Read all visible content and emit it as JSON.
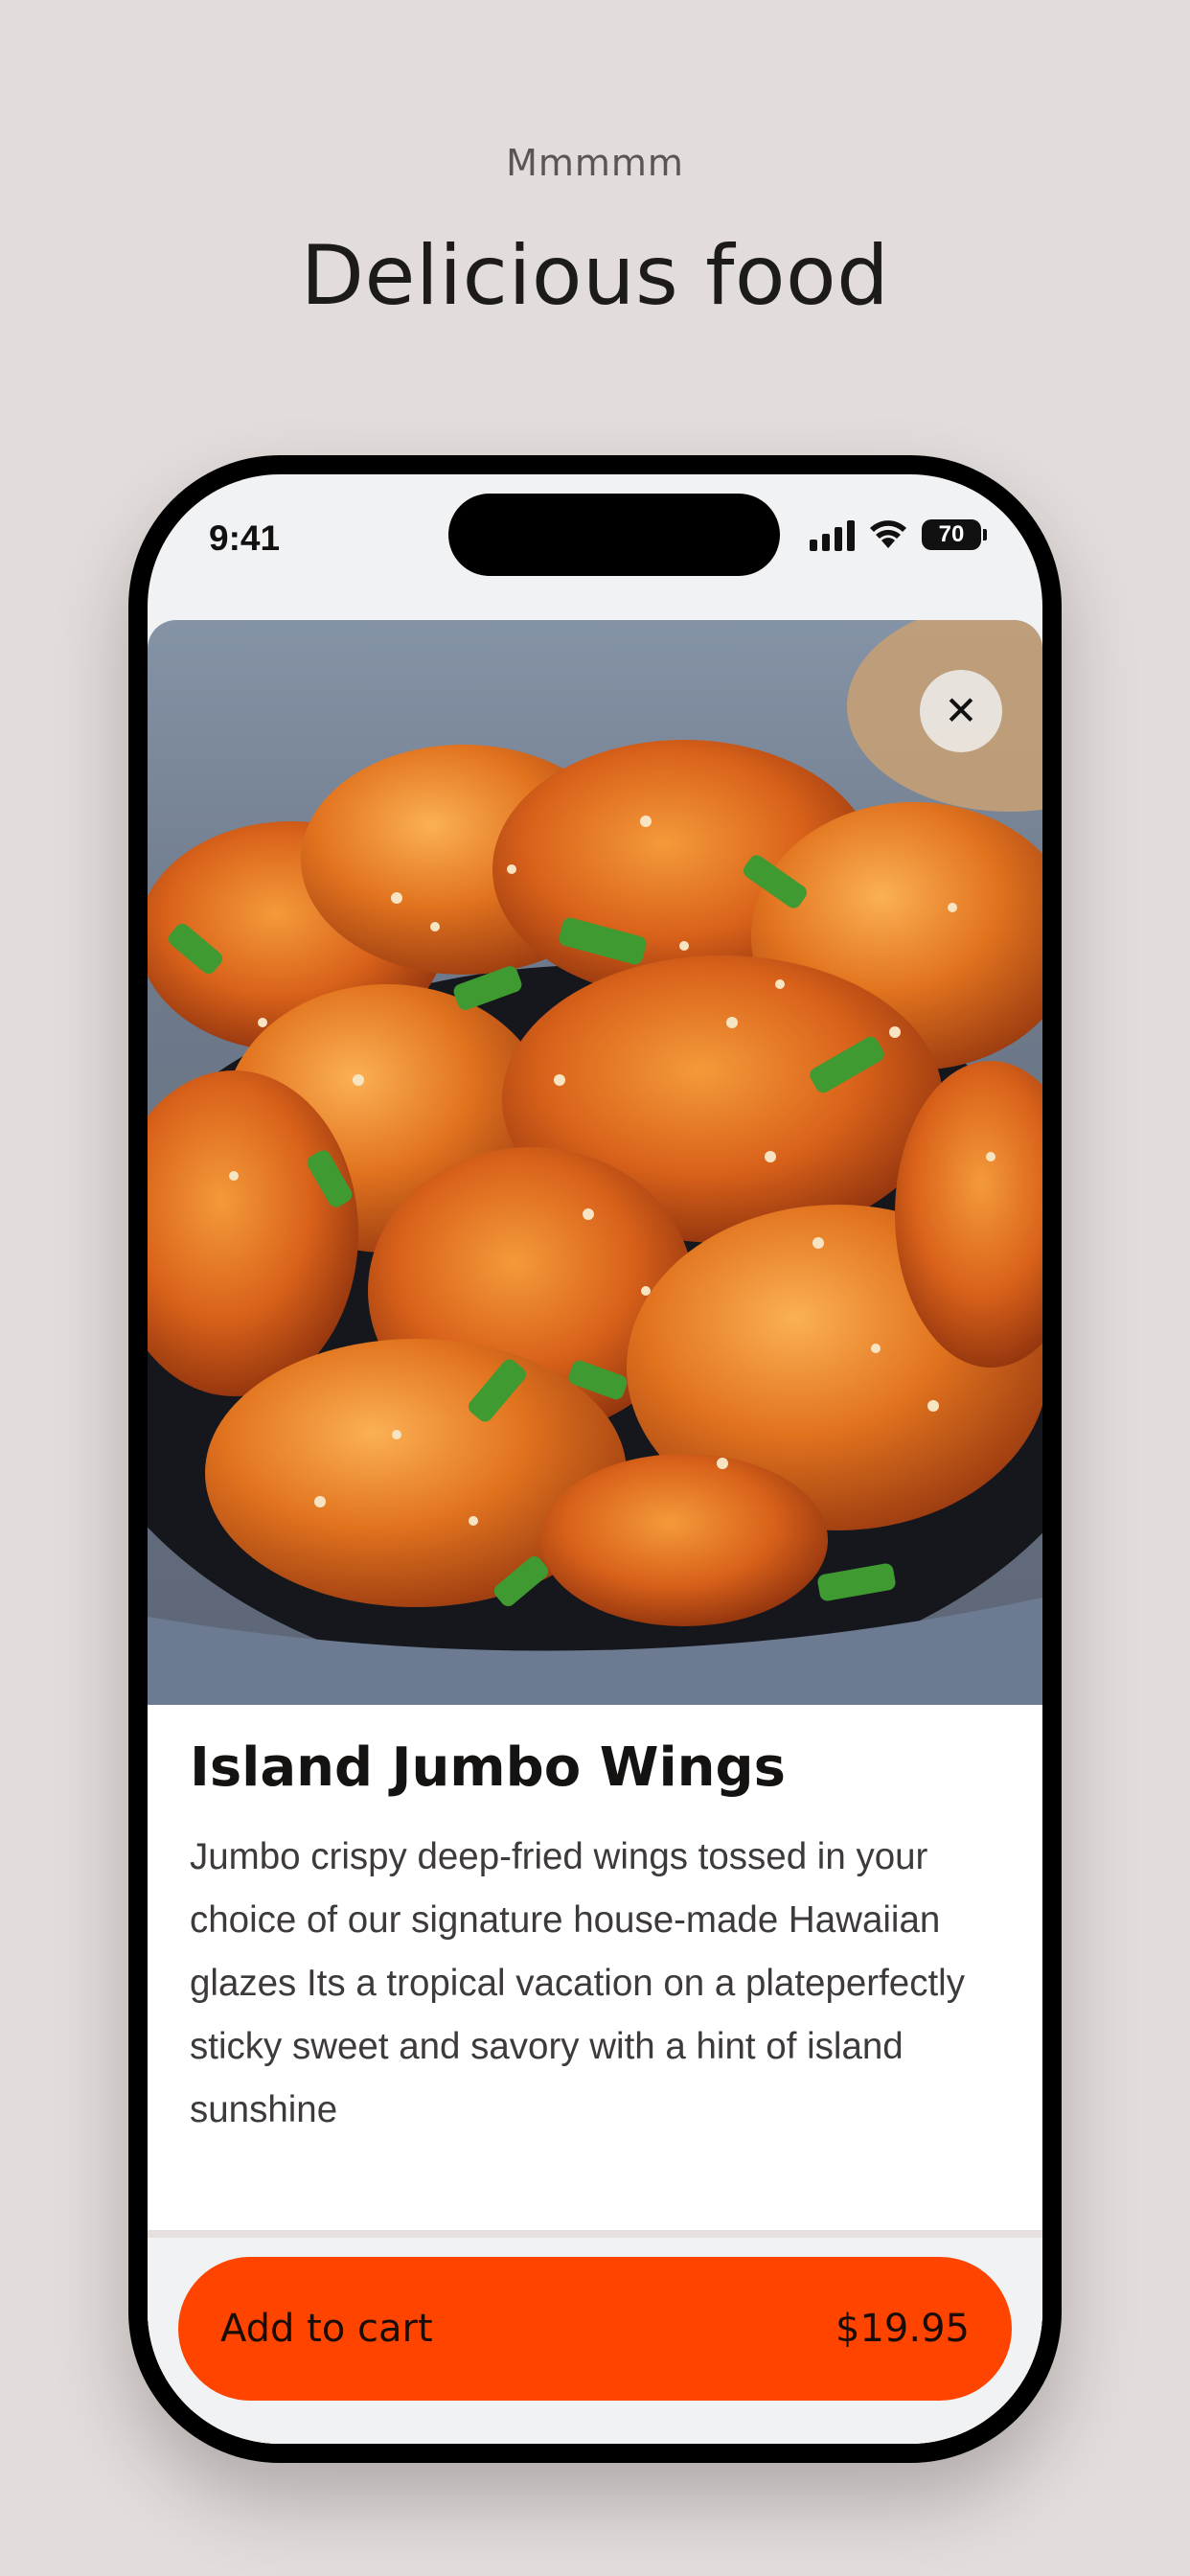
{
  "page": {
    "eyebrow": "Mmmmm",
    "headline": "Delicious food"
  },
  "status_bar": {
    "time": "9:41",
    "battery": "70",
    "icons": [
      "cellular-signal-icon",
      "wifi-icon",
      "battery-icon"
    ]
  },
  "product": {
    "image": "food-photo",
    "image_alt": "Glazed fried wings with sesame seeds and green onions",
    "close_icon": "close-icon",
    "title": "Island Jumbo Wings",
    "description": "Jumbo crispy deep-fried wings tossed in your choice of our signature house-made Hawaiian glazes Its a tropical vacation on a plateperfectly sticky sweet and savory with a hint of island sunshine"
  },
  "cart": {
    "label": "Add to cart",
    "price": "$19.95"
  },
  "colors": {
    "background": "#e2dcda",
    "accent": "#ff4400",
    "text": "#141312"
  }
}
